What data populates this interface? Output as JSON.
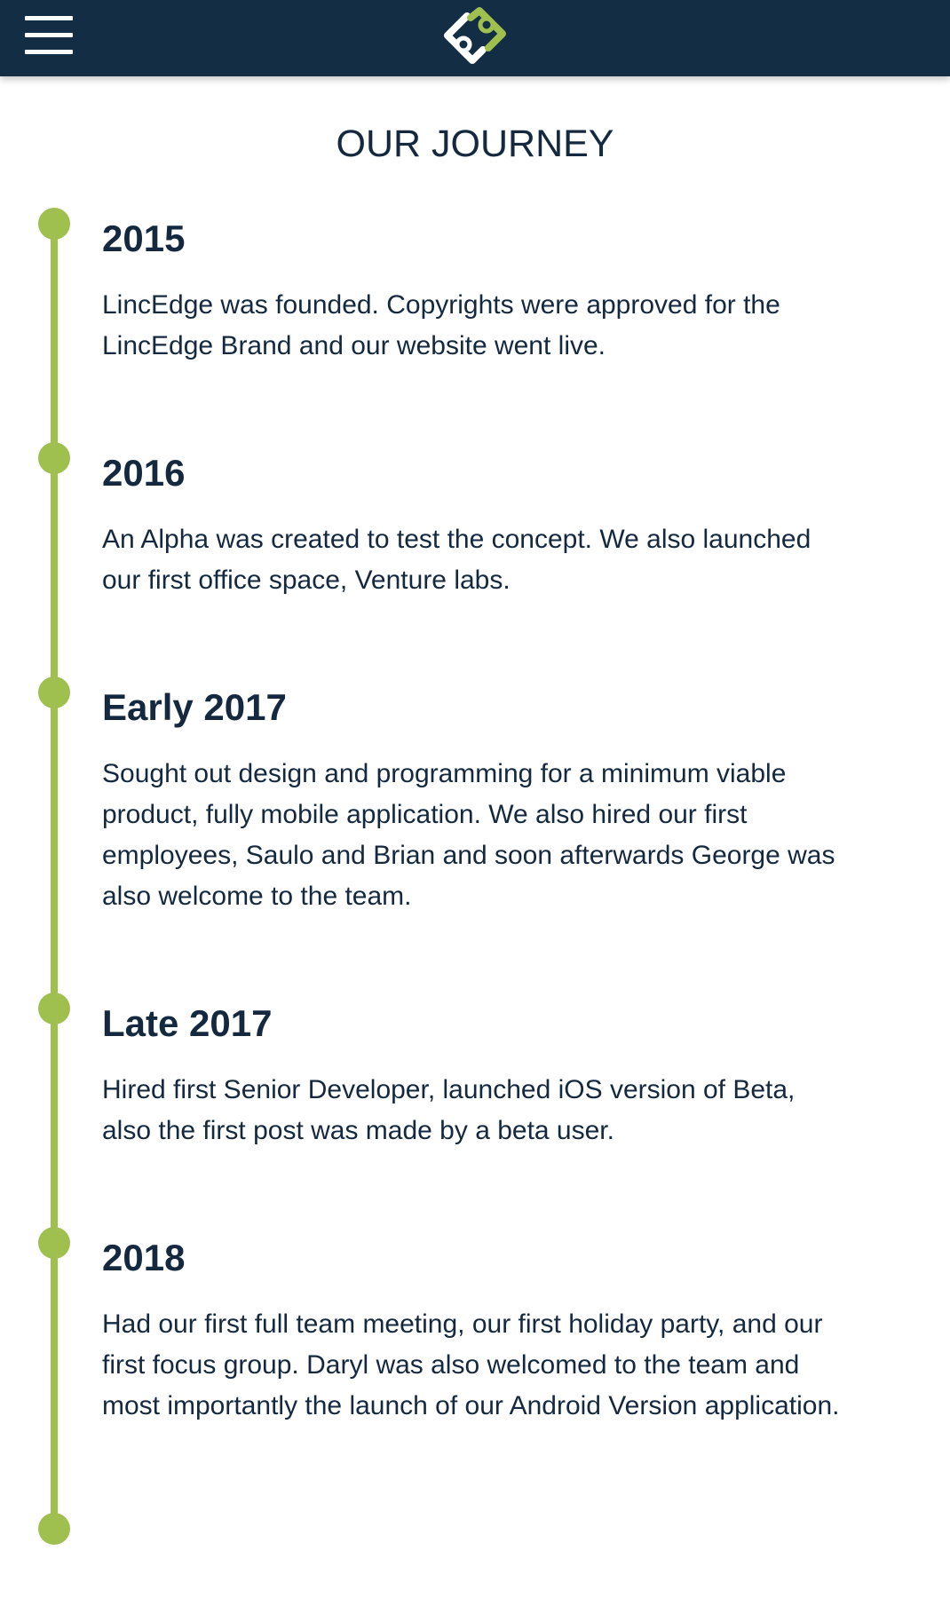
{
  "header": {
    "menu_icon": "hamburger-menu-icon",
    "logo_icon": "lincedge-logo",
    "colors": {
      "background": "#132d45",
      "accent": "#9fc04f"
    }
  },
  "page": {
    "title": "OUR JOURNEY"
  },
  "timeline": {
    "line_color": "#9fc04f",
    "entries": [
      {
        "year": "2015",
        "text": "LincEdge was founded. Copyrights were approved for the LincEdge Brand and our website went live."
      },
      {
        "year": "2016",
        "text": "An Alpha was created to test the concept. We also launched our first office space, Venture labs."
      },
      {
        "year": "Early 2017",
        "text": "Sought out design and programming for a minimum viable product, fully mobile application. We also hired our first employees, Saulo and Brian and soon afterwards George was also welcome to the team."
      },
      {
        "year": "Late 2017",
        "text": "Hired first Senior Developer, launched iOS version of Beta, also the first post was made by a beta user."
      },
      {
        "year": "2018",
        "text": "Had our first full team meeting, our first holiday party, and our first focus group. Daryl was also welcomed to the team and most importantly the launch of our Android Version application."
      }
    ]
  }
}
